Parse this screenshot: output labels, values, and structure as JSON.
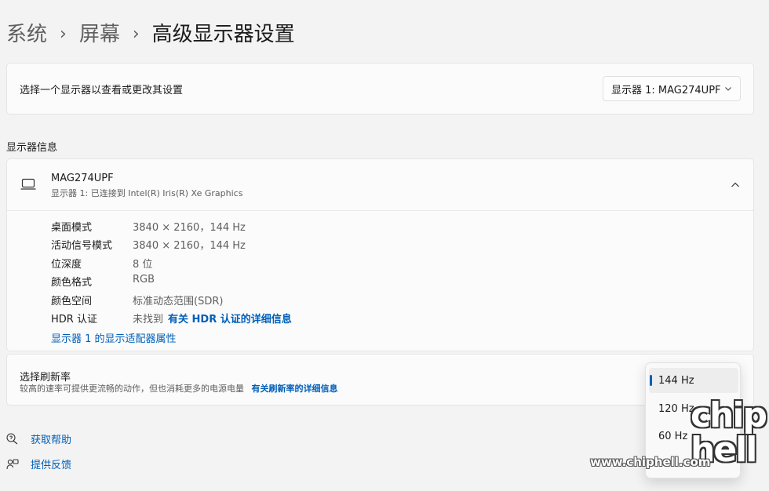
{
  "breadcrumb": {
    "level1": "系统",
    "level2": "屏幕",
    "current": "高级显示器设置",
    "separator": "›"
  },
  "select_display": {
    "label": "选择一个显示器以查看或更改其设置",
    "dropdown_value": "显示器 1: MAG274UPF"
  },
  "section_title": "显示器信息",
  "display_info": {
    "name": "MAG274UPF",
    "subtitle": "显示器 1: 已连接到 Intel(R) Iris(R) Xe Graphics",
    "rows": [
      {
        "key": "桌面模式",
        "value": "3840 × 2160，144 Hz"
      },
      {
        "key": "活动信号模式",
        "value": "3840 × 2160，144 Hz"
      },
      {
        "key": "位深度",
        "value": "8 位"
      },
      {
        "key": "颜色格式",
        "value": "RGB"
      },
      {
        "key": "颜色空间",
        "value": "标准动态范围(SDR)"
      }
    ],
    "hdr_key": "HDR 认证",
    "hdr_value": "未找到",
    "hdr_link": "有关 HDR 认证的详细信息",
    "adapter_link": "显示器 1 的显示适配器属性"
  },
  "refresh_rate": {
    "title": "选择刷新率",
    "description": "较高的速率可提供更流畅的动作，但也消耗更多的电源电量",
    "link": "有关刷新率的详细信息",
    "options": [
      "144 Hz",
      "120 Hz",
      "60 Hz"
    ],
    "selected": "144 Hz"
  },
  "footer": {
    "help": "获取帮助",
    "feedback": "提供反馈"
  },
  "watermark": {
    "url": "www.chiphell.com",
    "logo": "chip hell"
  },
  "colors": {
    "accent": "#005fb8",
    "background": "#f3f3f3",
    "card": "#fbfbfb"
  }
}
